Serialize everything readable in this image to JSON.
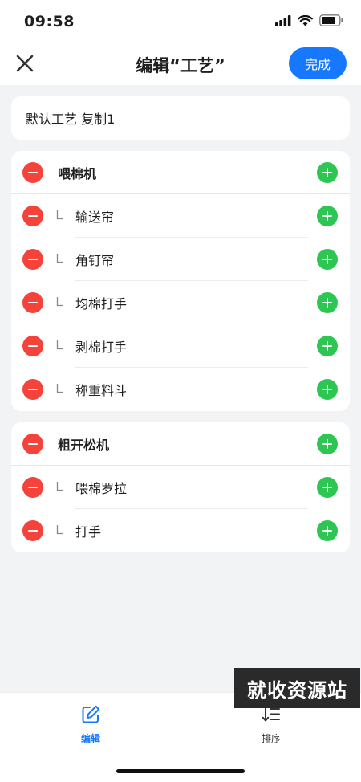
{
  "status": {
    "time": "09:58"
  },
  "nav": {
    "title": "编辑“工艺”",
    "done_label": "完成"
  },
  "name_field": {
    "value": "默认工艺 复制1"
  },
  "groups": [
    {
      "name": "喂棉机",
      "children": [
        "输送帘",
        "角钉帘",
        "均棉打手",
        "剥棉打手",
        "称重料斗"
      ]
    },
    {
      "name": "粗开松机",
      "children": [
        "喂棉罗拉",
        "打手"
      ]
    }
  ],
  "tabs": {
    "edit_label": "编辑",
    "sort_label": "排序"
  },
  "watermark": "就收资源站",
  "colors": {
    "accent": "#1677ff",
    "remove": "#f5423a",
    "add": "#2dc653"
  },
  "icons": {
    "close": "close-icon",
    "remove": "minus-circle-icon",
    "add": "plus-circle-icon",
    "branch": "branch-corner-icon",
    "edit_tab": "edit-icon",
    "sort_tab": "sort-icon"
  }
}
